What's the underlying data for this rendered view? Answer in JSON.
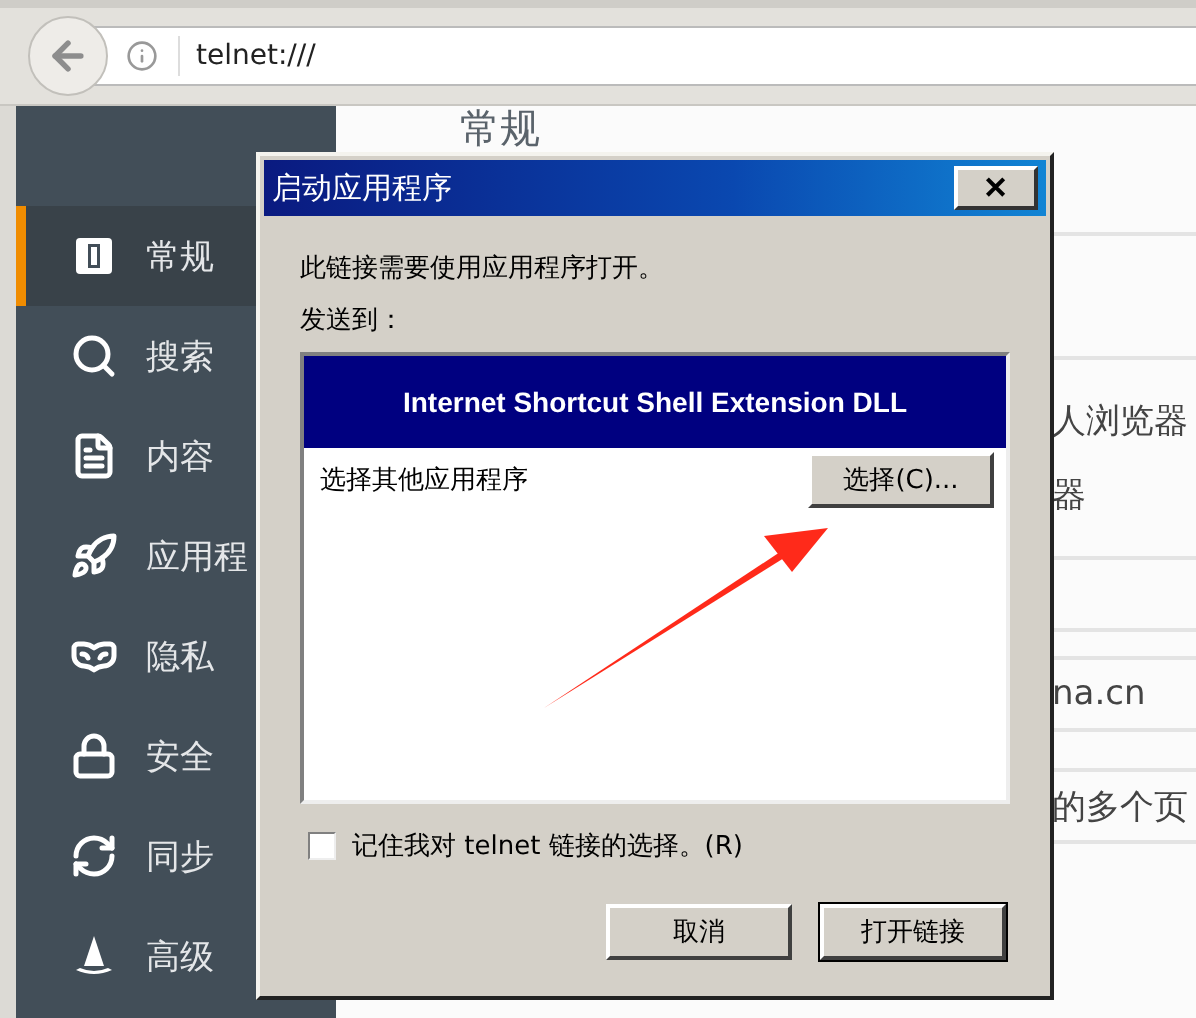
{
  "address_bar": {
    "url": "telnet:///"
  },
  "sidebar": {
    "items": [
      {
        "label": "常规",
        "selected": true
      },
      {
        "label": "搜索",
        "selected": false
      },
      {
        "label": "内容",
        "selected": false
      },
      {
        "label": "应用程",
        "selected": false
      },
      {
        "label": "隐私",
        "selected": false
      },
      {
        "label": "安全",
        "selected": false
      },
      {
        "label": "同步",
        "selected": false
      },
      {
        "label": "高级",
        "selected": false
      }
    ]
  },
  "page": {
    "heading": "常规",
    "fragments": [
      "人浏览器",
      "器",
      "na.cn",
      "的多个页"
    ]
  },
  "dialog": {
    "title": "启动应用程序",
    "close": "✕",
    "message": "此链接需要使用应用程序打开。",
    "send_to_label": "发送到：",
    "list": {
      "header": "Internet Shortcut Shell Extension DLL",
      "row_label": "选择其他应用程序",
      "row_button": "选择(C)..."
    },
    "remember": {
      "label": "记住我对 telnet 链接的选择。(R)",
      "checked": false
    },
    "buttons": [
      {
        "label": "取消",
        "default": false
      },
      {
        "label": "打开链接",
        "default": true
      }
    ]
  }
}
